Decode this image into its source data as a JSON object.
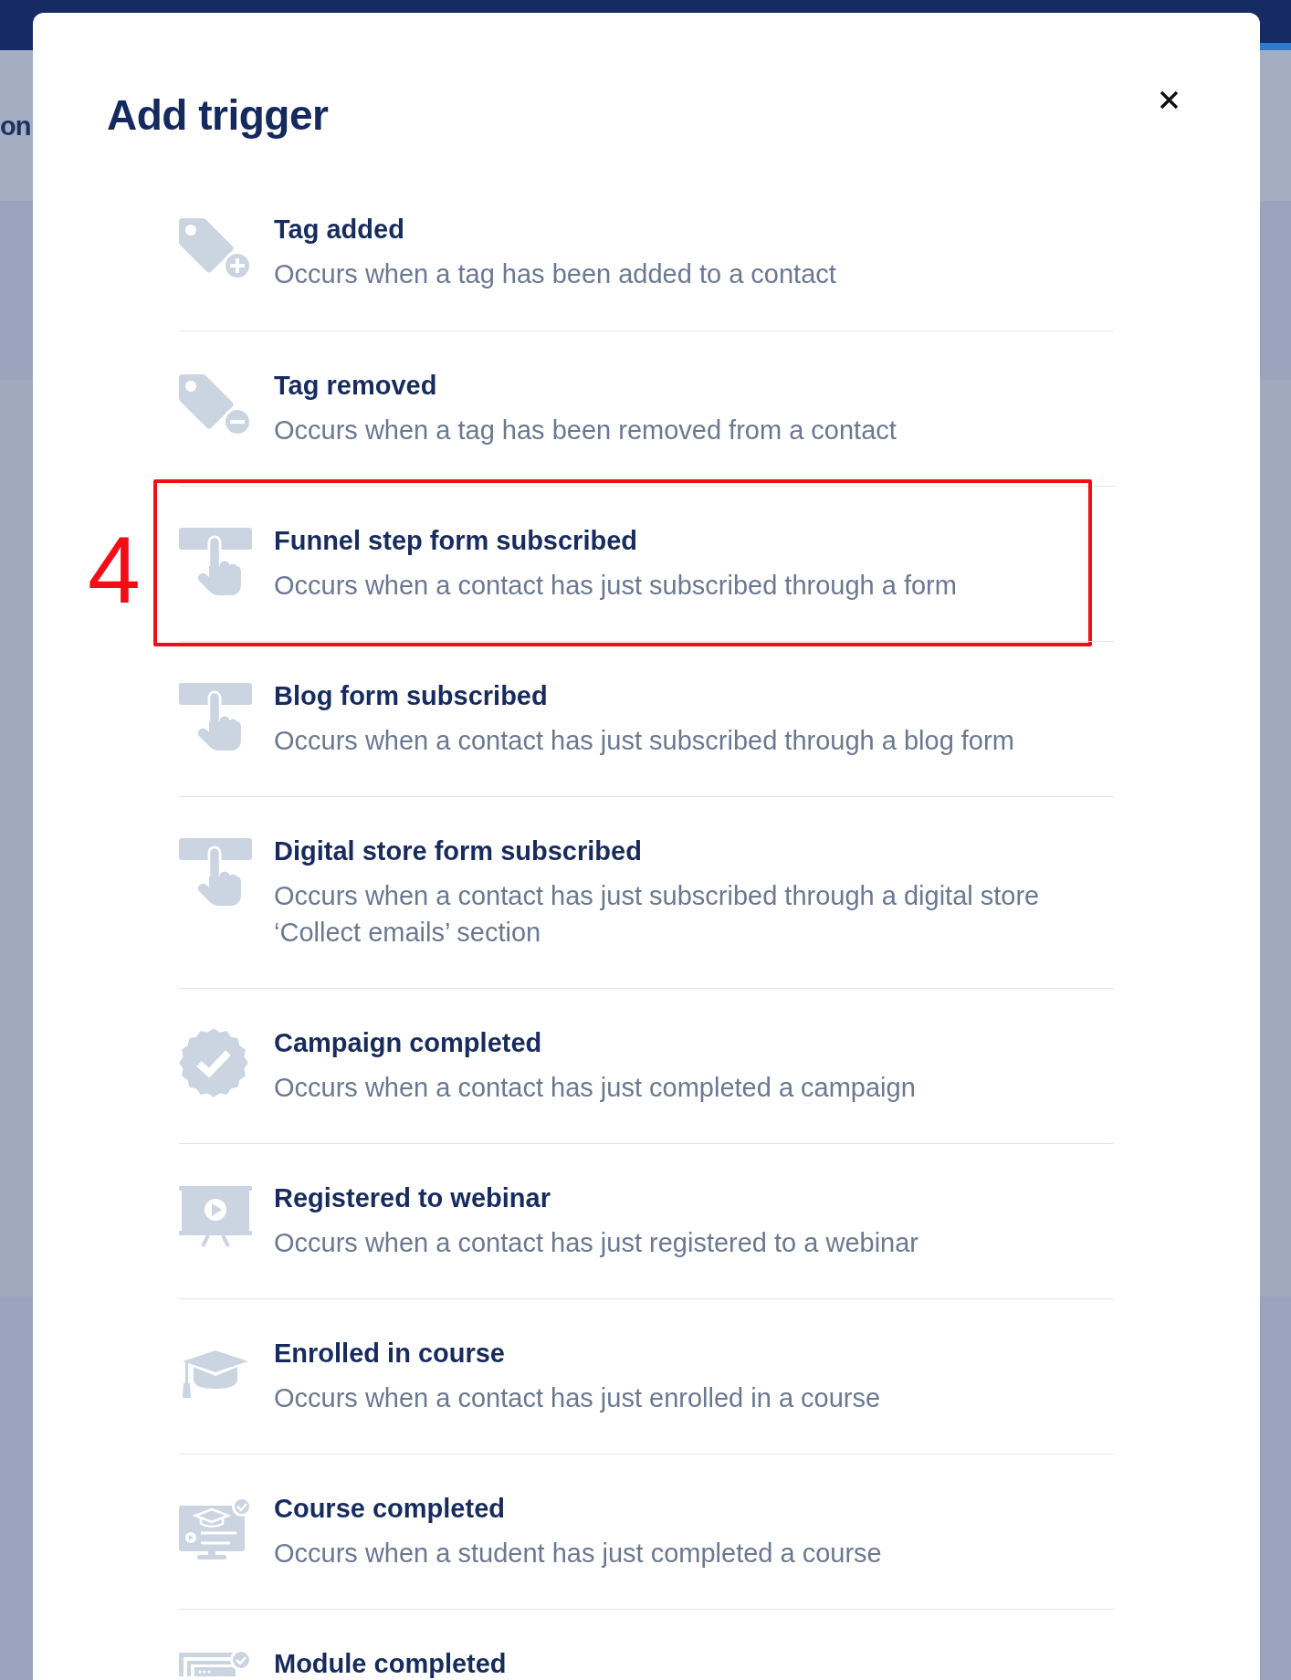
{
  "background": {
    "heading_fragment": "on"
  },
  "dialog": {
    "title": "Add trigger"
  },
  "annotation": {
    "label": "4"
  },
  "triggers": [
    {
      "title": "Tag added",
      "description": "Occurs when a tag has been added to a contact",
      "highlighted": false
    },
    {
      "title": "Tag removed",
      "description": "Occurs when a tag has been removed from a contact",
      "highlighted": false
    },
    {
      "title": "Funnel step form subscribed",
      "description": "Occurs when a contact has just subscribed through a form",
      "highlighted": true
    },
    {
      "title": "Blog form subscribed",
      "description": "Occurs when a contact has just subscribed through a blog form",
      "highlighted": false
    },
    {
      "title": "Digital store form subscribed",
      "description": "Occurs when a contact has just subscribed through a digital store ‘Collect emails’ section",
      "highlighted": false
    },
    {
      "title": "Campaign completed",
      "description": "Occurs when a contact has just completed a campaign",
      "highlighted": false
    },
    {
      "title": "Registered to webinar",
      "description": "Occurs when a contact has just registered to a webinar",
      "highlighted": false
    },
    {
      "title": "Enrolled in course",
      "description": "Occurs when a contact has just enrolled in a course",
      "highlighted": false
    },
    {
      "title": "Course completed",
      "description": "Occurs when a student has just completed a course",
      "highlighted": false
    },
    {
      "title": "Module completed",
      "highlighted": false
    }
  ]
}
